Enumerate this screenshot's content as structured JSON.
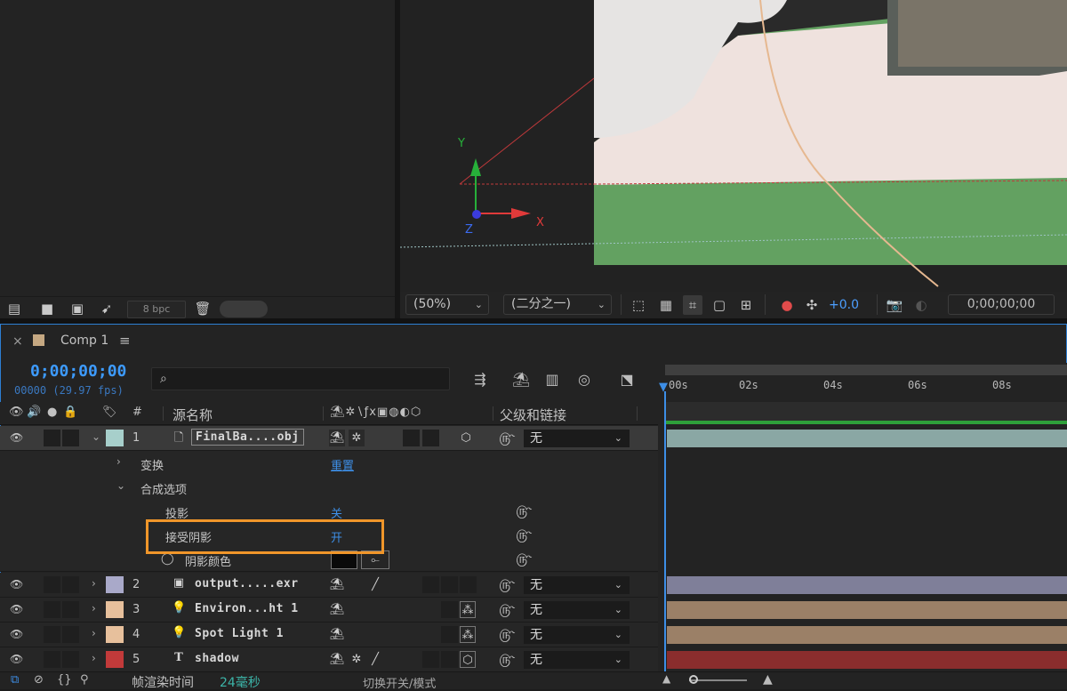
{
  "project": {
    "bpc": "8 bpc"
  },
  "viewer": {
    "zoom": "(50%)",
    "resolution": "(二分之一)",
    "exposure": "+0.0",
    "timecode": "0;00;00;00",
    "axis_y": "Y",
    "axis_x": "X",
    "axis_z": "Z"
  },
  "comp_tab": {
    "close": "×",
    "name": "Comp 1",
    "menu": "≡",
    "swatch_color": "#c5a882"
  },
  "timeline": {
    "timecode": "0;00;00;00",
    "fps": "00000 (29.97 fps)",
    "search_icon": "⌕",
    "ruler_ticks": [
      "00s",
      "02s",
      "04s",
      "06s",
      "08s"
    ]
  },
  "columns": {
    "num": "#",
    "source_name": "源名称",
    "parent": "父级和链接"
  },
  "layers": [
    {
      "num": "1",
      "name": "FinalBa....obj",
      "parent": "无",
      "label_color": "#a7cfcb",
      "bar_color": "#8aa7a4"
    },
    {
      "num": "2",
      "name": "output.....exr",
      "parent": "无",
      "label_color": "#a9a9c9",
      "bar_color": "#7f7f99"
    },
    {
      "num": "3",
      "name": "Environ...ht 1",
      "parent": "无",
      "label_color": "#e7c09c",
      "bar_color": "#9b8067"
    },
    {
      "num": "4",
      "name": "Spot Light 1",
      "parent": "无",
      "label_color": "#e7c09c",
      "bar_color": "#9b8067"
    },
    {
      "num": "5",
      "name": "shadow",
      "parent": "无",
      "label_color": "#c23a3a",
      "bar_color": "#8a2d2d"
    }
  ],
  "props": {
    "transform": "变换",
    "transform_value": "重置",
    "geometry": "合成选项",
    "cast_shadow": "投影",
    "cast_shadow_value": "关",
    "accept_shadow": "接受阴影",
    "accept_shadow_value": "开",
    "shadow_color": "阴影颜色"
  },
  "footer": {
    "render_label": "帧渲染时间",
    "render_time": "24毫秒",
    "toggle_label": "切换开关/模式"
  },
  "colors": {
    "accent": "#3d8ee6",
    "highlight": "#f0962a",
    "cache": "#2ea03a"
  }
}
